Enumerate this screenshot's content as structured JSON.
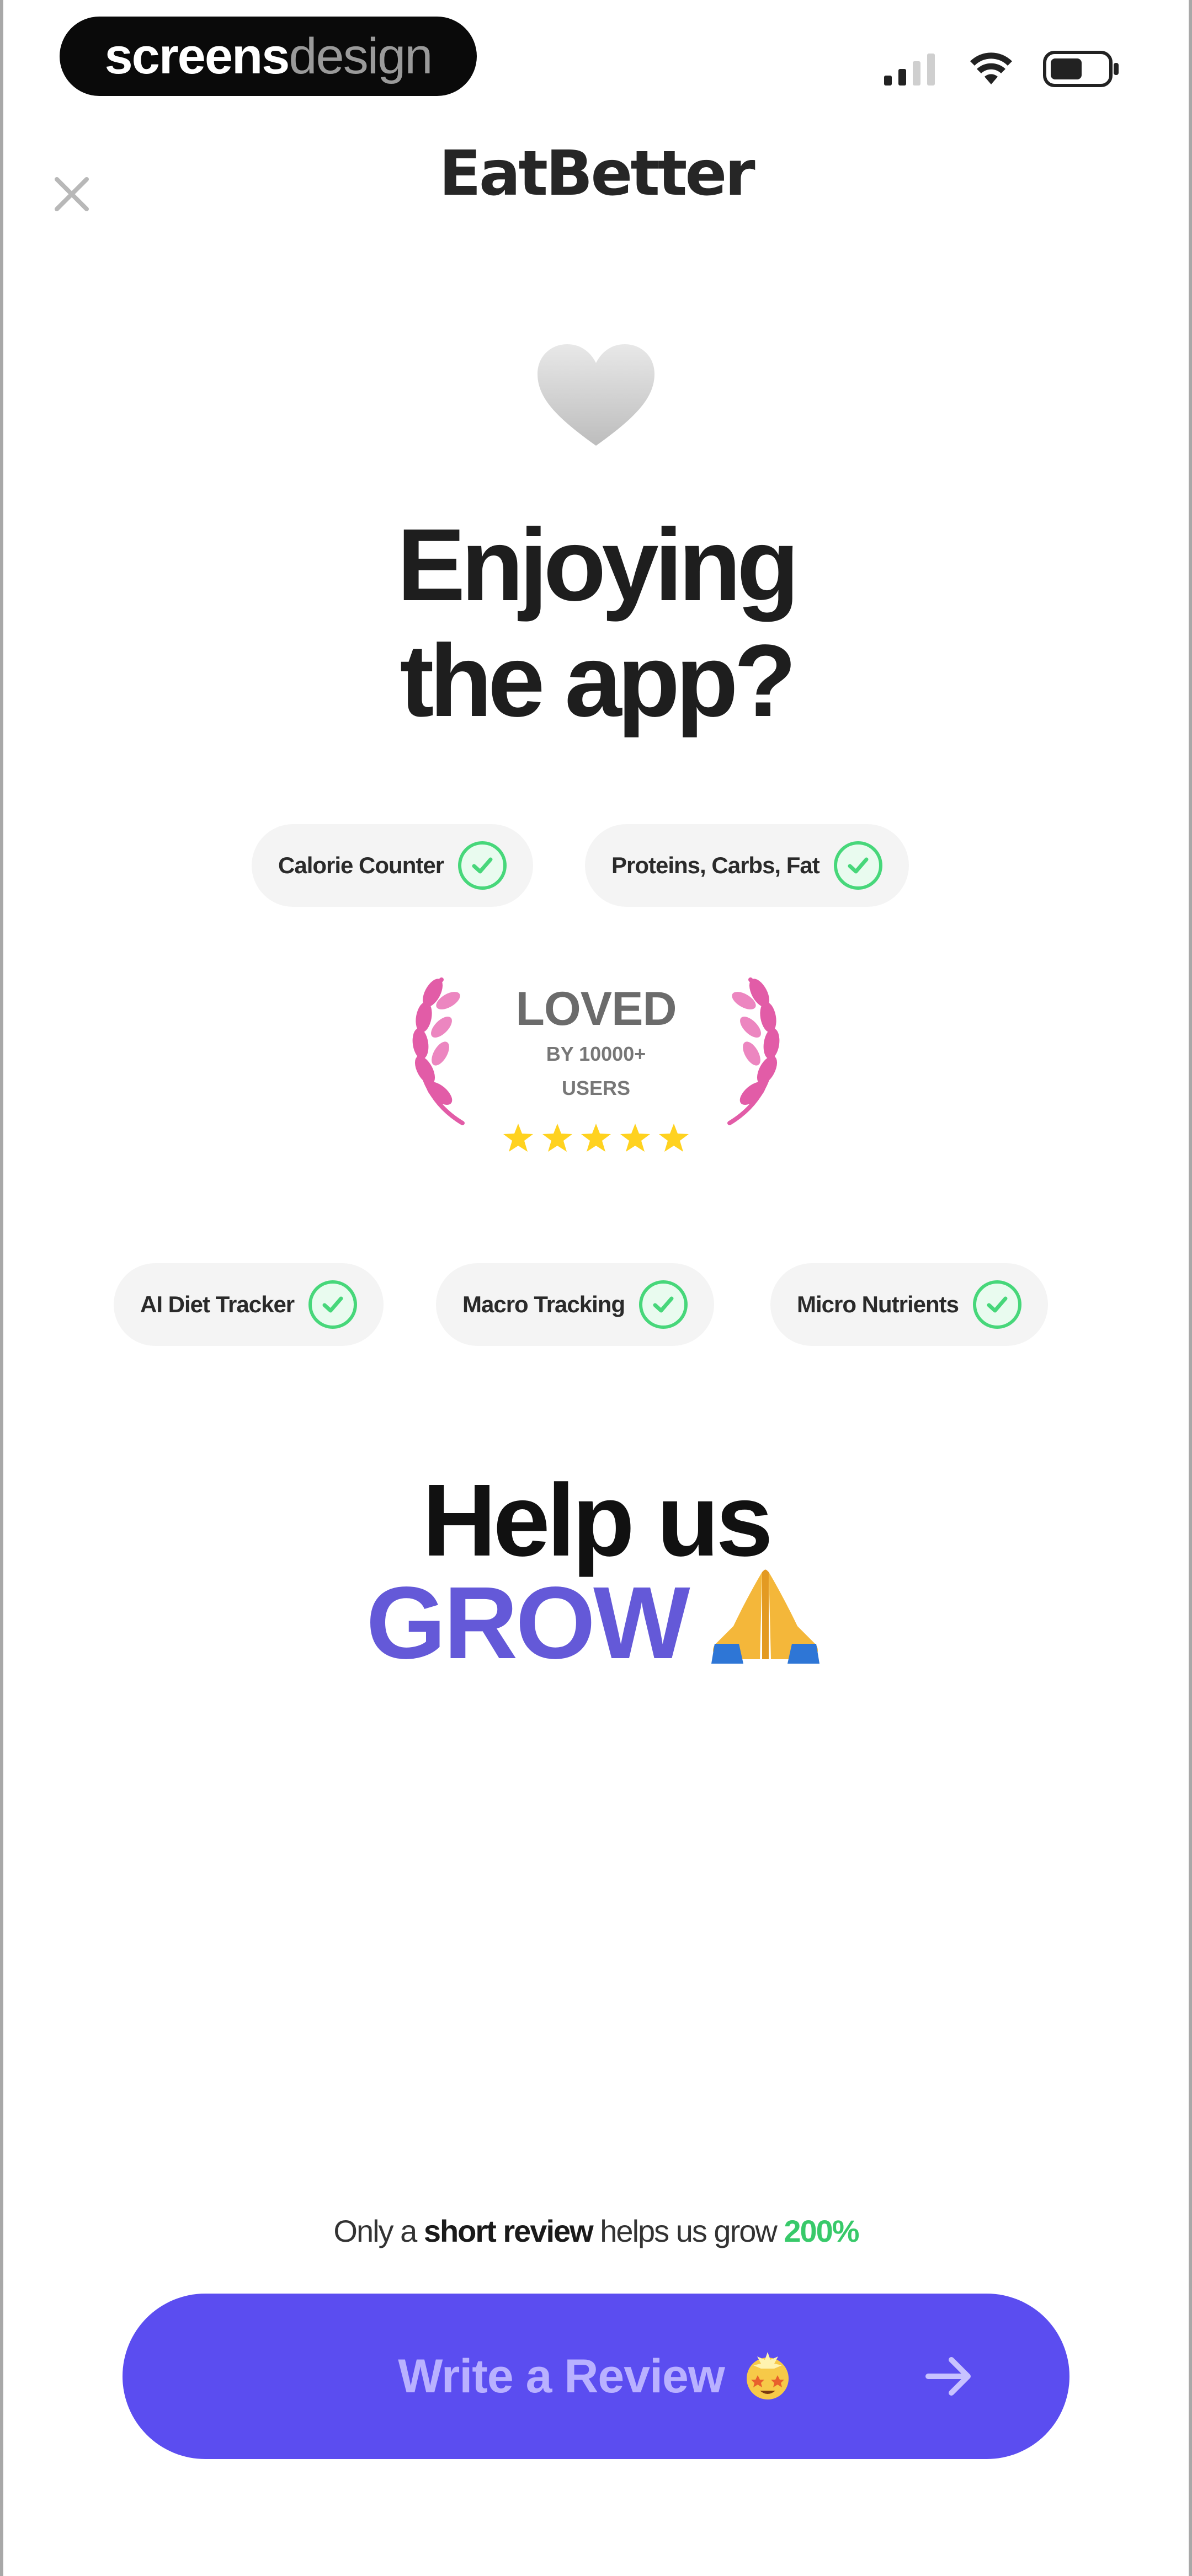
{
  "status_bar": {
    "brand_part1": "screens",
    "brand_part2": "design"
  },
  "header": {
    "title": "EatBetter",
    "close_icon": "close-icon"
  },
  "hero": {
    "icon": "heart-icon",
    "line1": "Enjoying",
    "line2": "the app?"
  },
  "features_top": [
    {
      "label": "Calorie Counter"
    },
    {
      "label": "Proteins, Carbs, Fat"
    }
  ],
  "badge": {
    "title": "LOVED",
    "sub1": "BY 10000+",
    "sub2": "USERS",
    "rating": 5
  },
  "features_bottom": [
    {
      "label": "AI Diet Tracker"
    },
    {
      "label": "Macro Tracking"
    },
    {
      "label": "Micro Nutrients"
    }
  ],
  "cta_section": {
    "line1": "Help us",
    "line2": "GROW"
  },
  "footnote": {
    "prefix": "Only a",
    "bold": "short review",
    "middle": "helps us grow",
    "percent": "200%"
  },
  "cta_button": {
    "label": "Write a Review"
  },
  "colors": {
    "accent": "#5b4df0",
    "grow": "#6459d8",
    "check": "#47d77a",
    "laurel": "#e25ca7",
    "star": "#ffd21f"
  }
}
